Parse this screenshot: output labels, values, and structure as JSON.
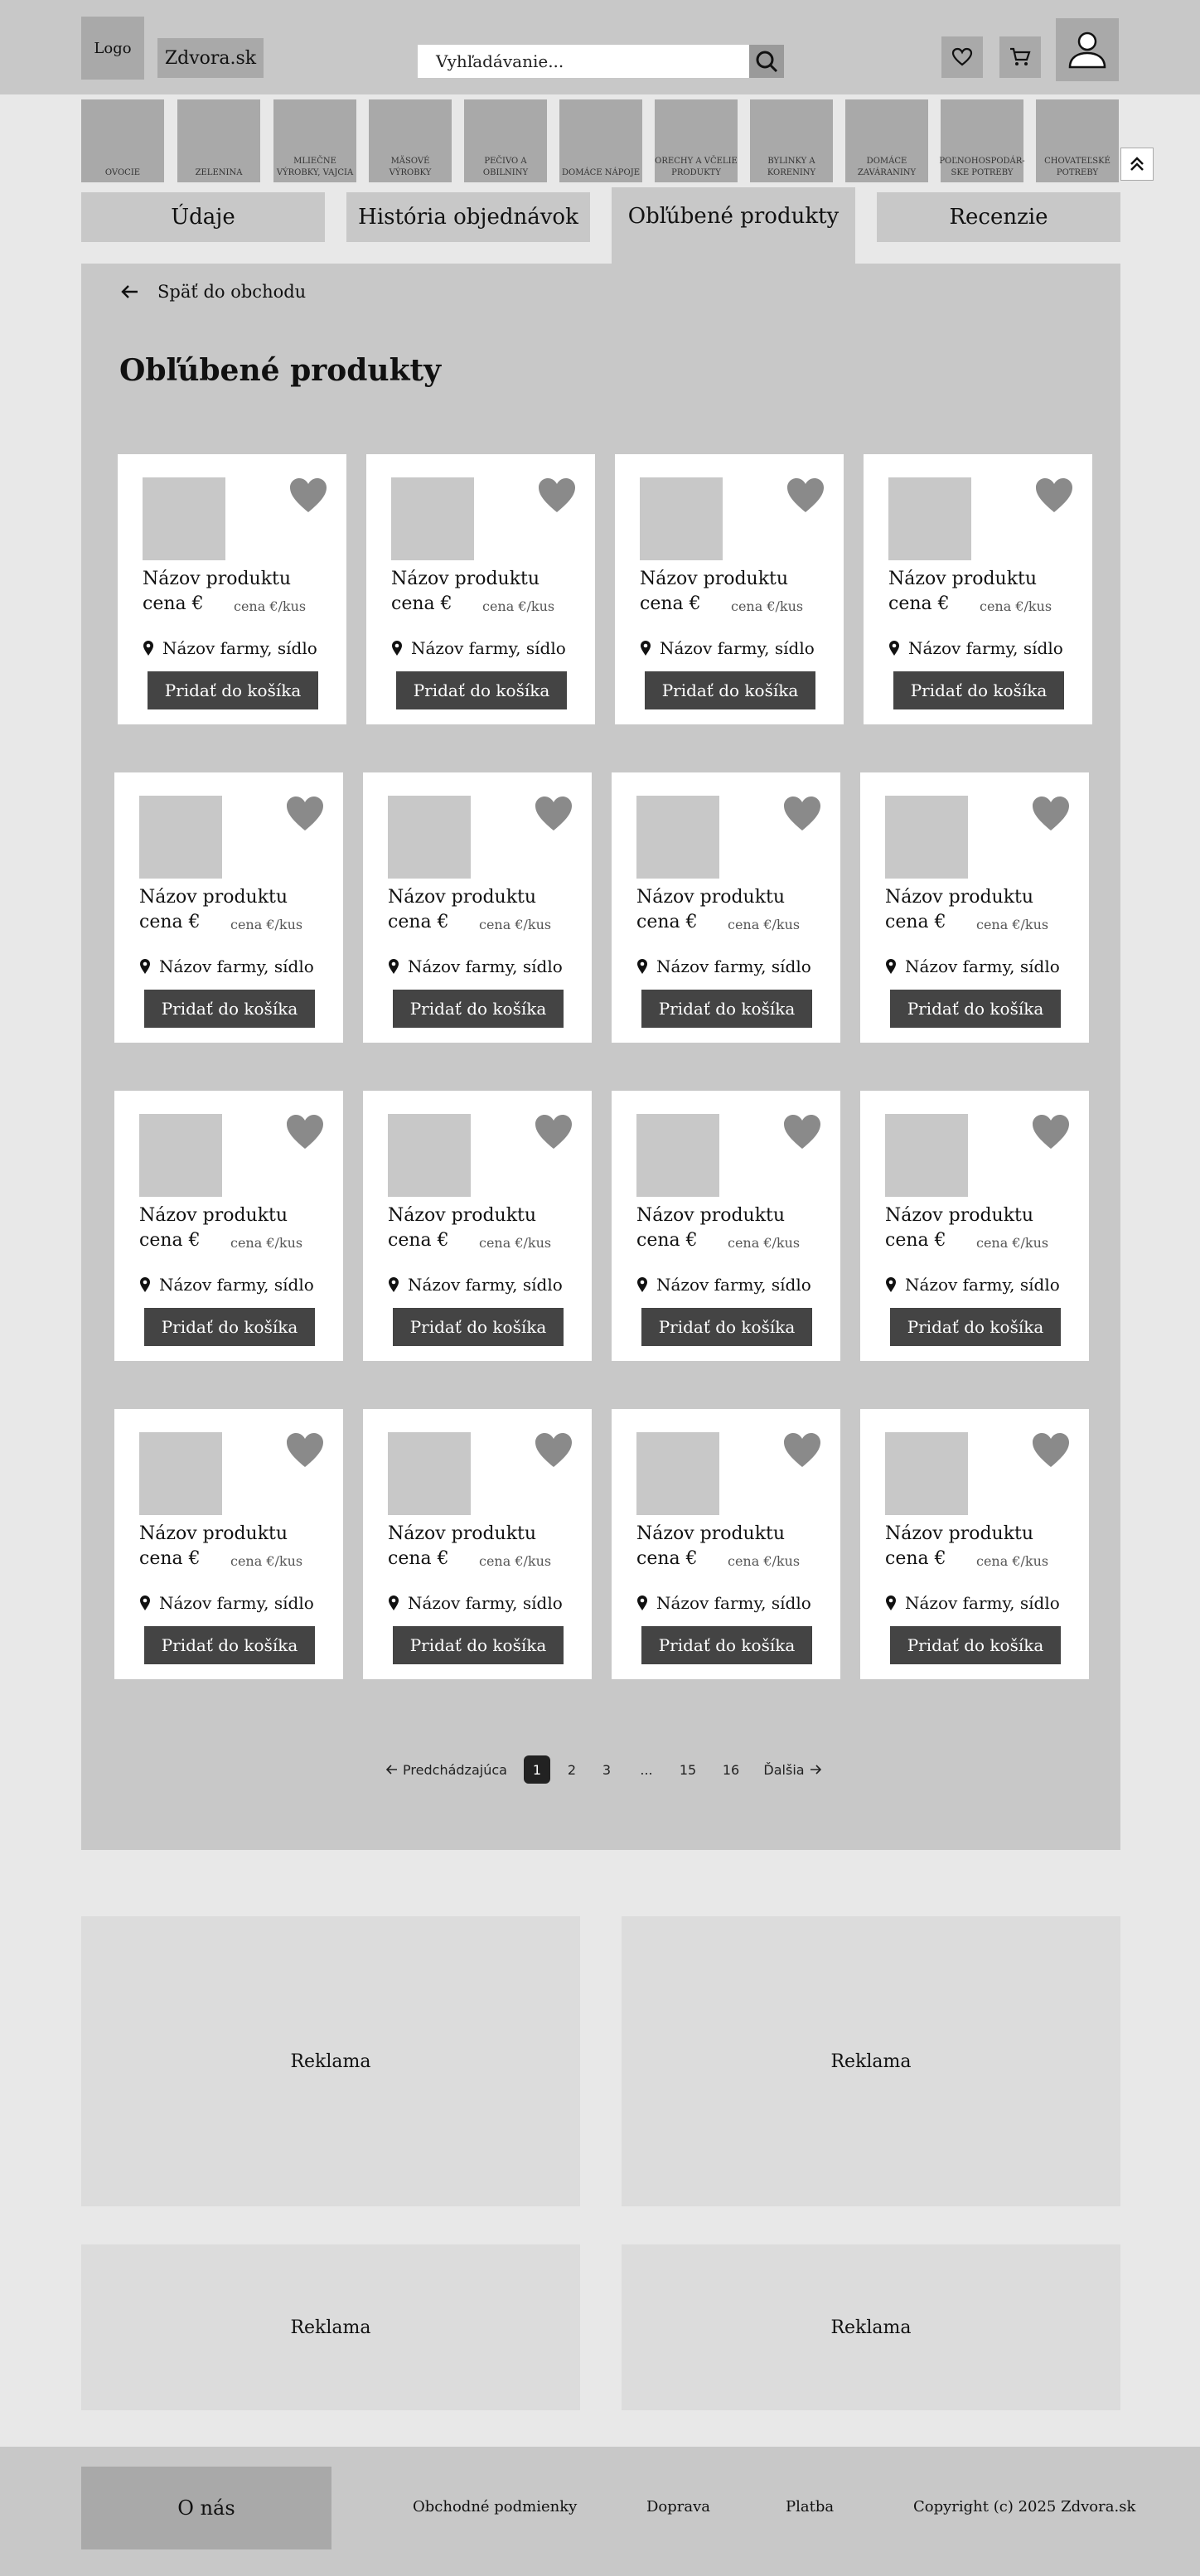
{
  "header": {
    "logo_label": "Logo",
    "brand_name": "Zdvora.sk",
    "search_placeholder": "Vyhľadávanie..."
  },
  "categories": [
    "OVOCIE",
    "ZELENINA",
    "MLIEČNE VÝROBKY, VAJCIA",
    "MÄSOVÉ VÝROBKY",
    "PEČIVO A OBILNINY",
    "DOMÁCE NÁPOJE",
    "ORECHY A VČELIE PRODUKTY",
    "BYLINKY A KORENINY",
    "DOMÁCE ZAVÁRANINY",
    "POĽNOHOSPODÁR-SKE POTREBY",
    "CHOVATEĽSKÉ POTREBY"
  ],
  "tabs": [
    "Údaje",
    "História objednávok",
    "Obľúbené produkty",
    "Recenzie"
  ],
  "main": {
    "back_label": "Späť do obchodu",
    "title": "Obľúbené produkty",
    "product": {
      "name": "Názov produktu",
      "price": "cena €",
      "unit_price": "cena €/kus",
      "farm": "Názov farmy, sídlo",
      "add_to_cart": "Pridať do košíka"
    },
    "pagination": {
      "prev": "Predchádzajúca",
      "pages": [
        "1",
        "2",
        "3",
        "...",
        "15",
        "16"
      ],
      "next": "Ďalšia",
      "current": "1"
    }
  },
  "ads": [
    "Reklama",
    "Reklama",
    "Reklama",
    "Reklama"
  ],
  "footer": {
    "about": "O nás",
    "links": [
      "Obchodné podmienky",
      "Doprava",
      "Platba"
    ],
    "copyright": "Copyright (c) 2025 Zdvora.sk"
  }
}
